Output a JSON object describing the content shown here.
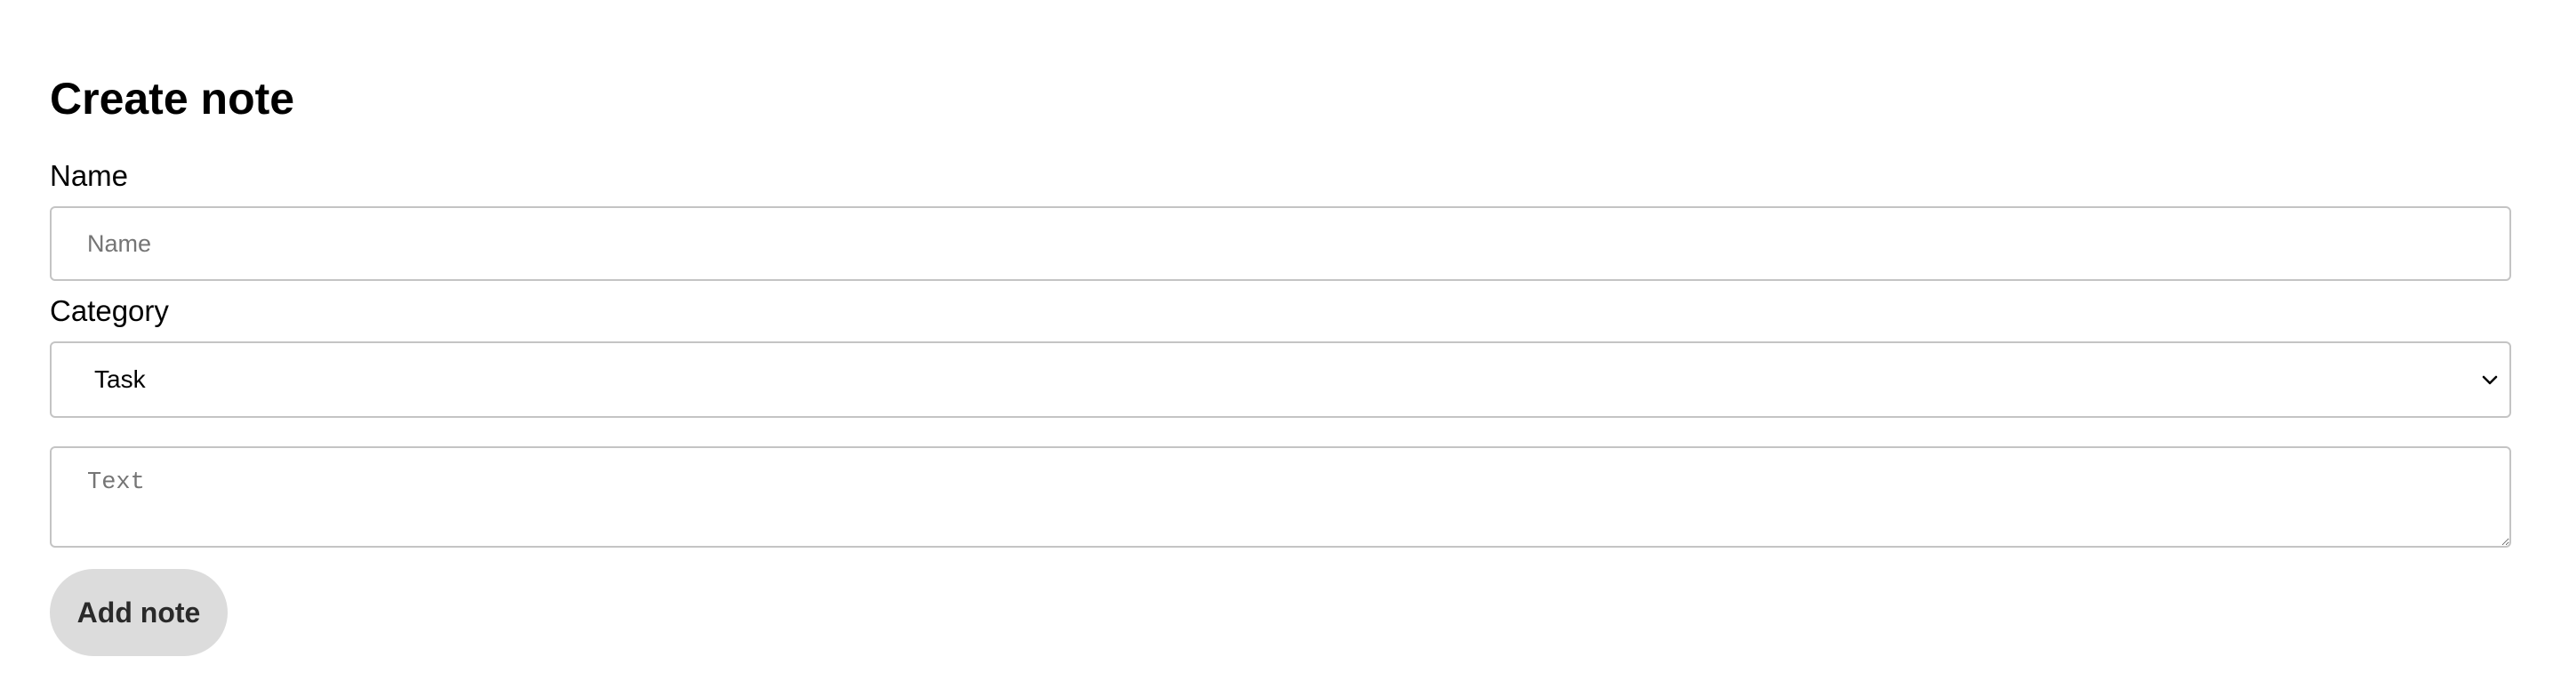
{
  "form": {
    "title": "Create note",
    "name_label": "Name",
    "name_placeholder": "Name",
    "name_value": "",
    "category_label": "Category",
    "category_selected": "Task",
    "text_placeholder": "Text",
    "text_value": "",
    "submit_label": "Add note"
  },
  "icons": {
    "select_indicator": "chevron-down-icon"
  }
}
